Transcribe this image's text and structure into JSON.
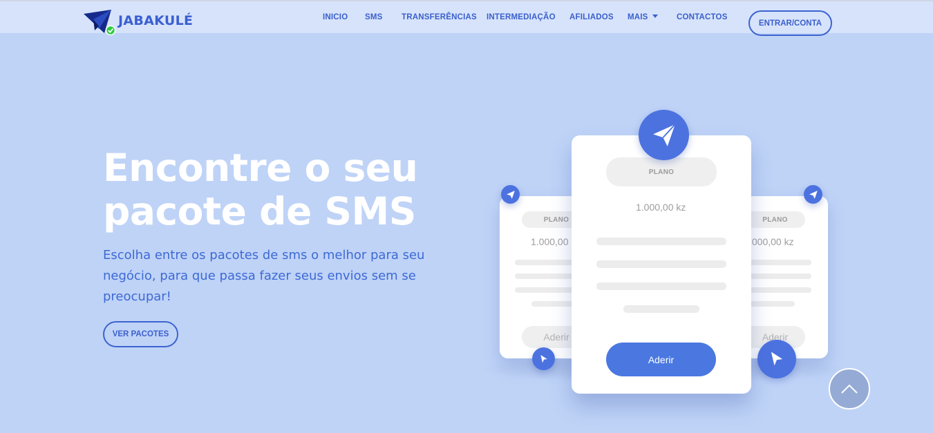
{
  "brand": {
    "name": "JABAKULÉ"
  },
  "nav": {
    "items": [
      {
        "label": "INICIO"
      },
      {
        "label": "SMS"
      },
      {
        "label": "TRANSFERÊNCIAS"
      },
      {
        "label": "INTERMEDIAÇÃO"
      },
      {
        "label": "AFILIADOS"
      },
      {
        "label": "MAIS"
      },
      {
        "label": "CONTACTOS"
      }
    ],
    "login_label": "ENTRAR/CONTA"
  },
  "hero": {
    "title_line1": "Encontre o seu",
    "title_line2": "pacote de SMS",
    "subtitle": "Escolha entre os pacotes de sms o melhor para seu negócio, para que passa fazer seus envios sem se preocupar!",
    "button_label": "VER PACOTES"
  },
  "cards": {
    "left": {
      "plan_label": "PLANO",
      "price": "1.000,00",
      "join_label": "Aderir"
    },
    "center": {
      "plan_label": "PLANO",
      "price": "1.000,00 kz",
      "join_label": "Aderir"
    },
    "right": {
      "plan_label": "PLANO",
      "price": ".000,00 kz",
      "join_label": "Aderir"
    }
  },
  "colors": {
    "background": "#bfd3f7",
    "navbar": "#d6e3fb",
    "accent": "#3b5fcc",
    "button_blue": "#4a78e0",
    "badge_green": "#2ecc40"
  },
  "icons": {
    "logo": "paper-plane-icon",
    "badge": "check-badge-icon",
    "card_circles": "paper-plane-icon",
    "scroll_top": "chevron-up-icon"
  }
}
